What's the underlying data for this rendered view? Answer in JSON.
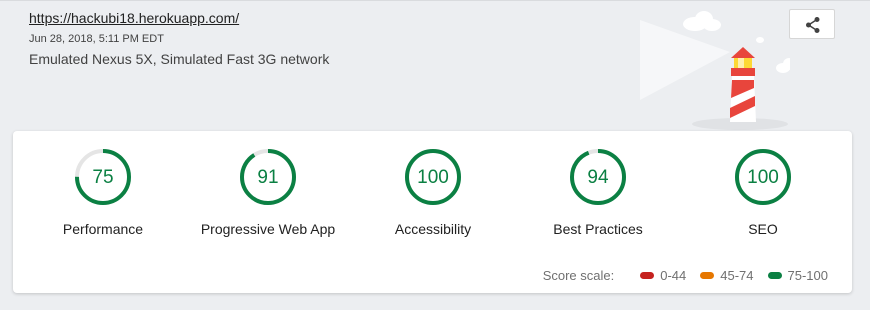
{
  "header": {
    "url": "https://hackubi18.herokuapp.com/",
    "timestamp": "Jun 28, 2018, 5:11 PM EDT",
    "environment": "Emulated Nexus 5X, Simulated Fast 3G network",
    "share_icon": "share-icon",
    "illustration_icon": "lighthouse-icon"
  },
  "gauges": [
    {
      "label": "Performance",
      "score": "75",
      "fraction": 0.75
    },
    {
      "label": "Progressive Web App",
      "score": "91",
      "fraction": 0.91
    },
    {
      "label": "Accessibility",
      "score": "100",
      "fraction": 1.0
    },
    {
      "label": "Best Practices",
      "score": "94",
      "fraction": 0.94
    },
    {
      "label": "SEO",
      "score": "100",
      "fraction": 1.0
    }
  ],
  "scale": {
    "title": "Score scale:",
    "items": [
      {
        "label": "0-44",
        "color": "#c5221f"
      },
      {
        "label": "45-74",
        "color": "#e67700"
      },
      {
        "label": "75-100",
        "color": "#0b8043"
      }
    ]
  },
  "colors": {
    "pass": "#0b8043",
    "track": "#e5e5e5",
    "header_bg": "#eceef1"
  }
}
